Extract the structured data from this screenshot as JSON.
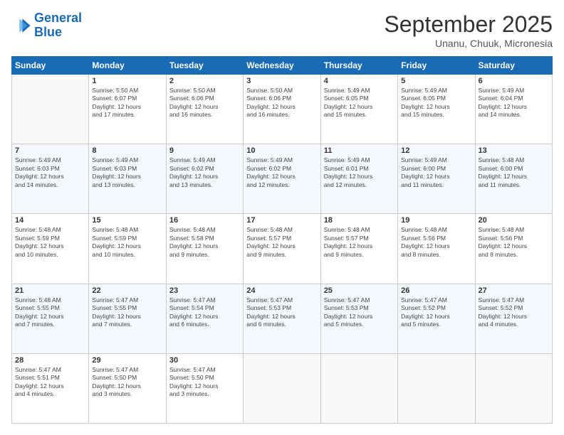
{
  "logo": {
    "line1": "General",
    "line2": "Blue"
  },
  "title": "September 2025",
  "subtitle": "Unanu, Chuuk, Micronesia",
  "days_of_week": [
    "Sunday",
    "Monday",
    "Tuesday",
    "Wednesday",
    "Thursday",
    "Friday",
    "Saturday"
  ],
  "weeks": [
    [
      {
        "day": "",
        "info": ""
      },
      {
        "day": "1",
        "info": "Sunrise: 5:50 AM\nSunset: 6:07 PM\nDaylight: 12 hours\nand 17 minutes."
      },
      {
        "day": "2",
        "info": "Sunrise: 5:50 AM\nSunset: 6:06 PM\nDaylight: 12 hours\nand 16 minutes."
      },
      {
        "day": "3",
        "info": "Sunrise: 5:50 AM\nSunset: 6:06 PM\nDaylight: 12 hours\nand 16 minutes."
      },
      {
        "day": "4",
        "info": "Sunrise: 5:49 AM\nSunset: 6:05 PM\nDaylight: 12 hours\nand 15 minutes."
      },
      {
        "day": "5",
        "info": "Sunrise: 5:49 AM\nSunset: 6:05 PM\nDaylight: 12 hours\nand 15 minutes."
      },
      {
        "day": "6",
        "info": "Sunrise: 5:49 AM\nSunset: 6:04 PM\nDaylight: 12 hours\nand 14 minutes."
      }
    ],
    [
      {
        "day": "7",
        "info": "Sunrise: 5:49 AM\nSunset: 6:03 PM\nDaylight: 12 hours\nand 14 minutes."
      },
      {
        "day": "8",
        "info": "Sunrise: 5:49 AM\nSunset: 6:03 PM\nDaylight: 12 hours\nand 13 minutes."
      },
      {
        "day": "9",
        "info": "Sunrise: 5:49 AM\nSunset: 6:02 PM\nDaylight: 12 hours\nand 13 minutes."
      },
      {
        "day": "10",
        "info": "Sunrise: 5:49 AM\nSunset: 6:02 PM\nDaylight: 12 hours\nand 12 minutes."
      },
      {
        "day": "11",
        "info": "Sunrise: 5:49 AM\nSunset: 6:01 PM\nDaylight: 12 hours\nand 12 minutes."
      },
      {
        "day": "12",
        "info": "Sunrise: 5:49 AM\nSunset: 6:00 PM\nDaylight: 12 hours\nand 11 minutes."
      },
      {
        "day": "13",
        "info": "Sunrise: 5:48 AM\nSunset: 6:00 PM\nDaylight: 12 hours\nand 11 minutes."
      }
    ],
    [
      {
        "day": "14",
        "info": "Sunrise: 5:48 AM\nSunset: 5:59 PM\nDaylight: 12 hours\nand 10 minutes."
      },
      {
        "day": "15",
        "info": "Sunrise: 5:48 AM\nSunset: 5:59 PM\nDaylight: 12 hours\nand 10 minutes."
      },
      {
        "day": "16",
        "info": "Sunrise: 5:48 AM\nSunset: 5:58 PM\nDaylight: 12 hours\nand 9 minutes."
      },
      {
        "day": "17",
        "info": "Sunrise: 5:48 AM\nSunset: 5:57 PM\nDaylight: 12 hours\nand 9 minutes."
      },
      {
        "day": "18",
        "info": "Sunrise: 5:48 AM\nSunset: 5:57 PM\nDaylight: 12 hours\nand 9 minutes."
      },
      {
        "day": "19",
        "info": "Sunrise: 5:48 AM\nSunset: 5:56 PM\nDaylight: 12 hours\nand 8 minutes."
      },
      {
        "day": "20",
        "info": "Sunrise: 5:48 AM\nSunset: 5:56 PM\nDaylight: 12 hours\nand 8 minutes."
      }
    ],
    [
      {
        "day": "21",
        "info": "Sunrise: 5:48 AM\nSunset: 5:55 PM\nDaylight: 12 hours\nand 7 minutes."
      },
      {
        "day": "22",
        "info": "Sunrise: 5:47 AM\nSunset: 5:55 PM\nDaylight: 12 hours\nand 7 minutes."
      },
      {
        "day": "23",
        "info": "Sunrise: 5:47 AM\nSunset: 5:54 PM\nDaylight: 12 hours\nand 6 minutes."
      },
      {
        "day": "24",
        "info": "Sunrise: 5:47 AM\nSunset: 5:53 PM\nDaylight: 12 hours\nand 6 minutes."
      },
      {
        "day": "25",
        "info": "Sunrise: 5:47 AM\nSunset: 5:53 PM\nDaylight: 12 hours\nand 5 minutes."
      },
      {
        "day": "26",
        "info": "Sunrise: 5:47 AM\nSunset: 5:52 PM\nDaylight: 12 hours\nand 5 minutes."
      },
      {
        "day": "27",
        "info": "Sunrise: 5:47 AM\nSunset: 5:52 PM\nDaylight: 12 hours\nand 4 minutes."
      }
    ],
    [
      {
        "day": "28",
        "info": "Sunrise: 5:47 AM\nSunset: 5:51 PM\nDaylight: 12 hours\nand 4 minutes."
      },
      {
        "day": "29",
        "info": "Sunrise: 5:47 AM\nSunset: 5:50 PM\nDaylight: 12 hours\nand 3 minutes."
      },
      {
        "day": "30",
        "info": "Sunrise: 5:47 AM\nSunset: 5:50 PM\nDaylight: 12 hours\nand 3 minutes."
      },
      {
        "day": "",
        "info": ""
      },
      {
        "day": "",
        "info": ""
      },
      {
        "day": "",
        "info": ""
      },
      {
        "day": "",
        "info": ""
      }
    ]
  ]
}
